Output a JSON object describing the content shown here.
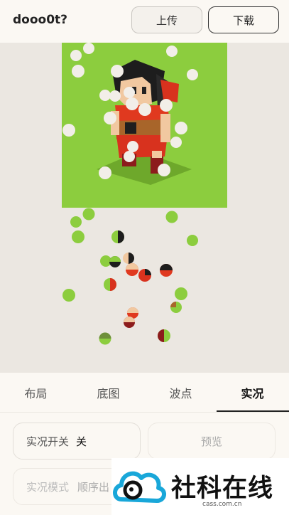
{
  "header": {
    "title": "dooo0t?",
    "upload_label": "上传",
    "download_label": "下载"
  },
  "tabs": [
    {
      "label": "布局",
      "active": false
    },
    {
      "label": "底图",
      "active": false
    },
    {
      "label": "波点",
      "active": false
    },
    {
      "label": "实况",
      "active": true
    }
  ],
  "settings": {
    "live_switch": {
      "label": "实况开关",
      "value": "关"
    },
    "preview_label": "预览",
    "live_mode": {
      "label": "实况模式",
      "value": "顺序出"
    }
  },
  "colors": {
    "canvas_green": "#8ccd3e",
    "accent_dark": "#222222"
  },
  "watermark": {
    "text": "社科在线",
    "url": "cass.com.cn"
  }
}
